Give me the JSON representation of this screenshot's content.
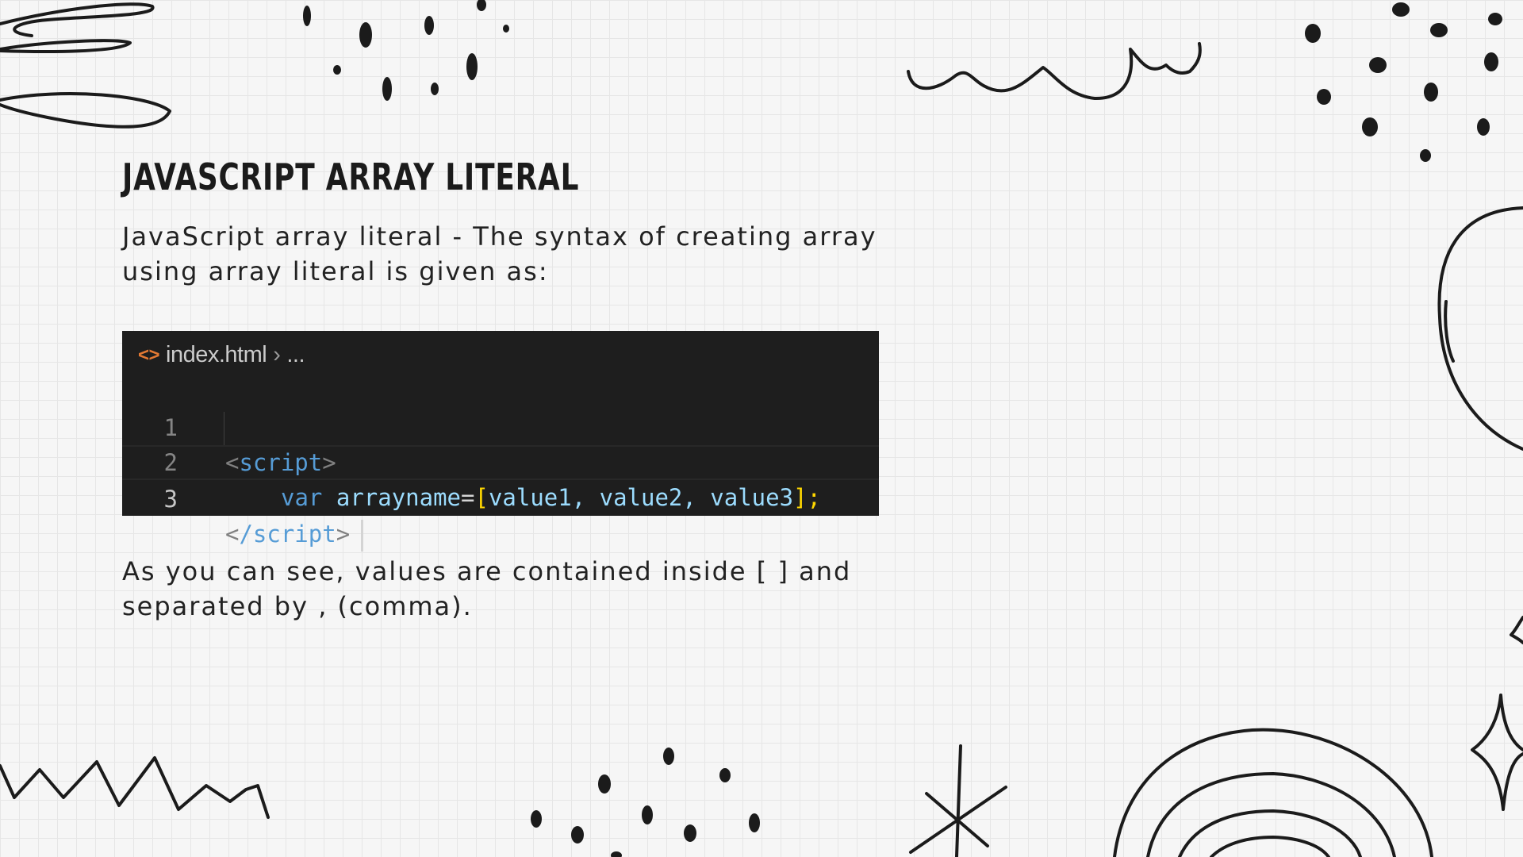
{
  "slide": {
    "title": "JavaScript Array Literal",
    "intro": "JavaScript array literal - The syntax of creating array using array literal is given as:",
    "outro": "As you can see, values are contained inside [ ] and separated by , (comma)."
  },
  "editor": {
    "breadcrumb_file": "index.html",
    "breadcrumb_more": "...",
    "file_icon": "html-tag-icon",
    "lines": [
      {
        "number": "1",
        "open_tag": "script"
      },
      {
        "number": "2",
        "keyword": "var",
        "identifier": "arrayname",
        "op": "=",
        "open_bracket": "[",
        "values": "value1, value2, value3",
        "close": "];"
      },
      {
        "number": "3",
        "close_tag": "/script"
      }
    ]
  },
  "colors": {
    "background": "#f6f6f6",
    "editor_bg": "#1e1e1e",
    "keyword": "#569cd6",
    "variable": "#9cdcfe",
    "bracket": "#ffd700",
    "tag_punct": "#808080"
  }
}
